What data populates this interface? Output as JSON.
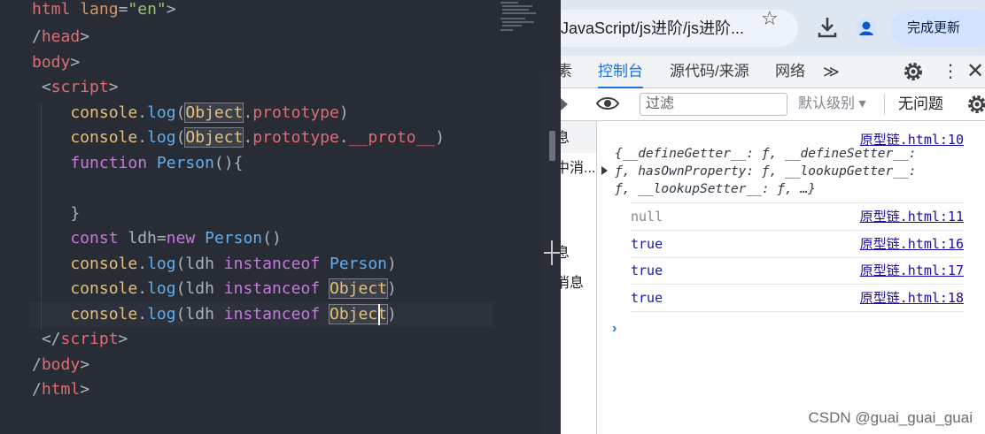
{
  "editor": {
    "lines": [
      {
        "tokens": [
          {
            "t": "html",
            "c": "t-tag"
          },
          {
            "t": " ",
            "c": "t-plain"
          },
          {
            "t": "lang",
            "c": "t-attr"
          },
          {
            "t": "=",
            "c": "t-punc"
          },
          {
            "t": "\"en\"",
            "c": "t-str"
          },
          {
            "t": ">",
            "c": "t-punc"
          }
        ]
      },
      {
        "tokens": [
          {
            "t": "/",
            "c": "t-punc"
          },
          {
            "t": "head",
            "c": "t-tag"
          },
          {
            "t": ">",
            "c": "t-punc"
          }
        ]
      },
      {
        "tokens": [
          {
            "t": "body",
            "c": "t-tag"
          },
          {
            "t": ">",
            "c": "t-punc"
          }
        ]
      },
      {
        "tokens": [
          {
            "t": " <",
            "c": "t-punc"
          },
          {
            "t": "script",
            "c": "t-tag"
          },
          {
            "t": ">",
            "c": "t-punc"
          }
        ]
      },
      {
        "tokens": [
          {
            "t": "    console",
            "c": "t-cls"
          },
          {
            "t": ".",
            "c": "t-punc"
          },
          {
            "t": "log",
            "c": "t-fn"
          },
          {
            "t": "(",
            "c": "t-punc"
          },
          {
            "t": "Object",
            "c": "t-cls hl"
          },
          {
            "t": ".",
            "c": "t-punc"
          },
          {
            "t": "prototype",
            "c": "t-prop"
          },
          {
            "t": ")",
            "c": "t-punc"
          }
        ]
      },
      {
        "tokens": [
          {
            "t": "    console",
            "c": "t-cls"
          },
          {
            "t": ".",
            "c": "t-punc"
          },
          {
            "t": "log",
            "c": "t-fn"
          },
          {
            "t": "(",
            "c": "t-punc"
          },
          {
            "t": "Object",
            "c": "t-cls hl"
          },
          {
            "t": ".",
            "c": "t-punc"
          },
          {
            "t": "prototype",
            "c": "t-prop"
          },
          {
            "t": ".",
            "c": "t-punc"
          },
          {
            "t": "__proto__",
            "c": "t-prop"
          },
          {
            "t": ")",
            "c": "t-punc"
          }
        ]
      },
      {
        "tokens": [
          {
            "t": "    function",
            "c": "t-kw"
          },
          {
            "t": " ",
            "c": "t-plain"
          },
          {
            "t": "Person",
            "c": "t-fn"
          },
          {
            "t": "(){",
            "c": "t-punc"
          }
        ]
      },
      {
        "tokens": [
          {
            "t": "",
            "c": "t-plain"
          }
        ]
      },
      {
        "tokens": [
          {
            "t": "    }",
            "c": "t-punc"
          }
        ]
      },
      {
        "tokens": [
          {
            "t": "    const",
            "c": "t-kw"
          },
          {
            "t": " ldh",
            "c": "t-plain"
          },
          {
            "t": "=",
            "c": "t-punc"
          },
          {
            "t": "new",
            "c": "t-kw"
          },
          {
            "t": " ",
            "c": "t-plain"
          },
          {
            "t": "Person",
            "c": "t-fn"
          },
          {
            "t": "()",
            "c": "t-punc"
          }
        ]
      },
      {
        "tokens": [
          {
            "t": "    console",
            "c": "t-cls"
          },
          {
            "t": ".",
            "c": "t-punc"
          },
          {
            "t": "log",
            "c": "t-fn"
          },
          {
            "t": "(",
            "c": "t-punc"
          },
          {
            "t": "ldh ",
            "c": "t-plain"
          },
          {
            "t": "instanceof",
            "c": "t-kw"
          },
          {
            "t": " ",
            "c": "t-plain"
          },
          {
            "t": "Person",
            "c": "t-fn"
          },
          {
            "t": ")",
            "c": "t-punc"
          }
        ]
      },
      {
        "tokens": [
          {
            "t": "    console",
            "c": "t-cls"
          },
          {
            "t": ".",
            "c": "t-punc"
          },
          {
            "t": "log",
            "c": "t-fn"
          },
          {
            "t": "(",
            "c": "t-punc"
          },
          {
            "t": "ldh ",
            "c": "t-plain"
          },
          {
            "t": "instanceof",
            "c": "t-kw"
          },
          {
            "t": " ",
            "c": "t-plain"
          },
          {
            "t": "Object",
            "c": "t-cls hl"
          },
          {
            "t": ")",
            "c": "t-punc"
          }
        ]
      },
      {
        "tokens": [
          {
            "t": "    console",
            "c": "t-cls"
          },
          {
            "t": ".",
            "c": "t-punc"
          },
          {
            "t": "log",
            "c": "t-fn"
          },
          {
            "t": "(",
            "c": "t-punc"
          },
          {
            "t": "ldh ",
            "c": "t-plain"
          },
          {
            "t": "instanceof",
            "c": "t-kw"
          },
          {
            "t": " ",
            "c": "t-plain"
          },
          {
            "t": "Object",
            "c": "t-cls hl"
          },
          {
            "t": ")",
            "c": "t-punc"
          }
        ]
      },
      {
        "tokens": [
          {
            "t": " </",
            "c": "t-punc"
          },
          {
            "t": "script",
            "c": "t-tag"
          },
          {
            "t": ">",
            "c": "t-punc"
          }
        ]
      },
      {
        "tokens": [
          {
            "t": "/",
            "c": "t-punc"
          },
          {
            "t": "body",
            "c": "t-tag"
          },
          {
            "t": ">",
            "c": "t-punc"
          }
        ]
      },
      {
        "tokens": [
          {
            "t": "/",
            "c": "t-punc"
          },
          {
            "t": "html",
            "c": "t-tag"
          },
          {
            "t": ">",
            "c": "t-punc"
          }
        ]
      }
    ]
  },
  "browser": {
    "url": "JavaScript/js进阶/js进阶...",
    "star_icon": "star-icon",
    "download_icon": "download-icon",
    "profile_icon": "profile-icon",
    "update_button": "完成更新"
  },
  "devtools": {
    "tab_partial": "素",
    "tab_console": "控制台",
    "tab_sources": "源代码/来源",
    "tab_network": "网络",
    "more_tabs": "≫",
    "filter_placeholder": "过滤",
    "levels": "默认级别 ▾",
    "no_issues": "无问题",
    "sidebar": [
      "息",
      "中消...",
      "息",
      "消息"
    ]
  },
  "console": {
    "entries": [
      {
        "value": "",
        "source": "原型链.html:10"
      },
      {
        "value": "null",
        "source": "原型链.html:11"
      },
      {
        "value": "true",
        "source": "原型链.html:16"
      },
      {
        "value": "true",
        "source": "原型链.html:17"
      },
      {
        "value": "true",
        "source": "原型链.html:18"
      }
    ],
    "object_lines": [
      "{__defineGetter__: ƒ, __defineSetter__:",
      "ƒ, hasOwnProperty: ƒ, __lookupGetter__:",
      "ƒ, __lookupSetter__: ƒ, …}"
    ],
    "prompt": "›"
  },
  "watermark": "CSDN @guai_guai_guai",
  "colors": {
    "editor_bg": "#282c34",
    "accent": "#1a73e8",
    "link": "#1a0dab"
  }
}
